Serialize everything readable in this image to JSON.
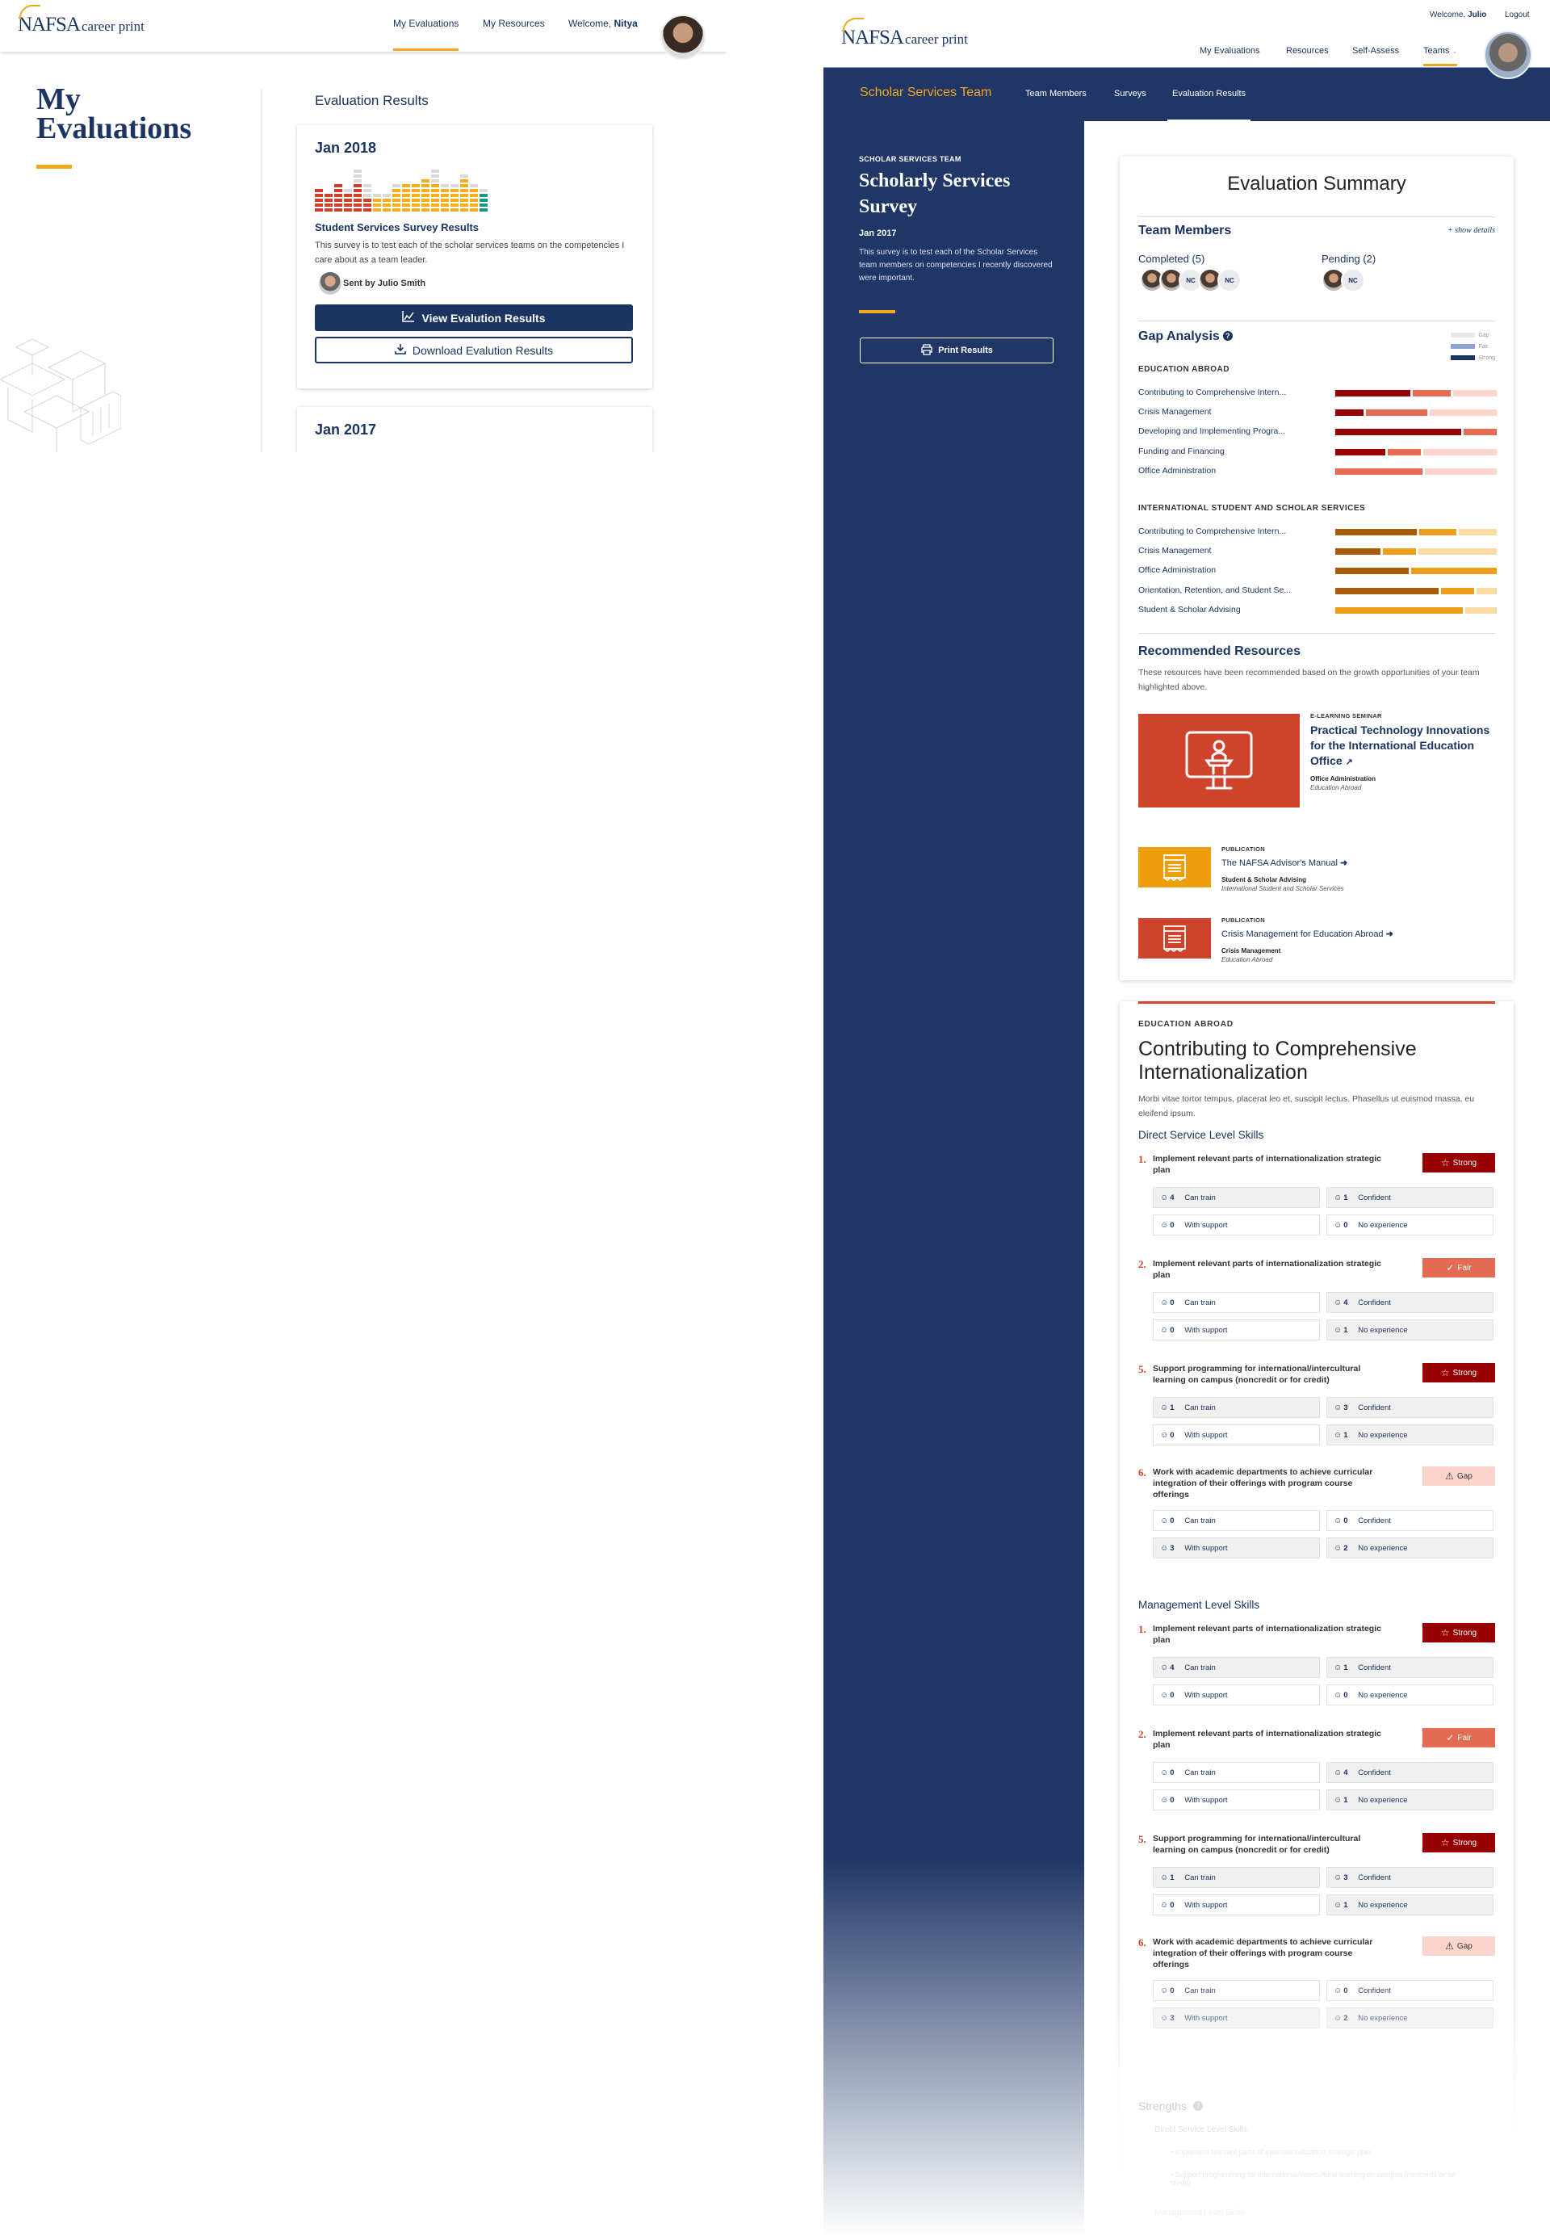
{
  "left": {
    "logo": {
      "brand": "NAFSA",
      "product": "career print"
    },
    "nav": [
      {
        "label": "My Evaluations",
        "active": true
      },
      {
        "label": "My Resources",
        "active": false
      }
    ],
    "welcome_prefix": "Welcome, ",
    "welcome_name": "Nitya",
    "page_title_line1": "My",
    "page_title_line2": "Evaluations",
    "section_title": "Evaluation Results",
    "cards": [
      {
        "date": "Jan 2018",
        "chart_columns": [
          {
            "color": "red",
            "filled": 5,
            "empty": 0
          },
          {
            "color": "red",
            "filled": 4,
            "empty": 0
          },
          {
            "color": "red",
            "filled": 6,
            "empty": 0
          },
          {
            "color": "red",
            "filled": 4,
            "empty": 1
          },
          {
            "color": "red",
            "filled": 6,
            "empty": 3
          },
          {
            "color": "red",
            "filled": 3,
            "empty": 3
          },
          {
            "color": "yellow",
            "filled": 3,
            "empty": 1
          },
          {
            "color": "yellow",
            "filled": 3,
            "empty": 1
          },
          {
            "color": "yellow",
            "filled": 5,
            "empty": 1
          },
          {
            "color": "yellow",
            "filled": 6,
            "empty": 0
          },
          {
            "color": "yellow",
            "filled": 6,
            "empty": 0
          },
          {
            "color": "yellow",
            "filled": 7,
            "empty": 0
          },
          {
            "color": "yellow",
            "filled": 6,
            "empty": 3
          },
          {
            "color": "yellow",
            "filled": 5,
            "empty": 1
          },
          {
            "color": "yellow",
            "filled": 5,
            "empty": 1
          },
          {
            "color": "yellow",
            "filled": 7,
            "empty": 1
          },
          {
            "color": "yellow",
            "filled": 5,
            "empty": 1
          },
          {
            "color": "green",
            "filled": 4,
            "empty": 1
          }
        ],
        "survey_title": "Student Services Survey Results",
        "survey_desc": "This survey is to test each of the scholar services teams on the competencies I care about as a team leader.",
        "sent_by": "Sent by Julio Smith",
        "view_label": "View Evalution Results",
        "download_label": "Download Evalution Results"
      },
      {
        "date": "Jan 2017"
      }
    ]
  },
  "right": {
    "logo": {
      "brand": "NAFSA",
      "product": "career print"
    },
    "welcome_prefix": "Welcome, ",
    "welcome_name": "Julio",
    "logout_label": "Logout",
    "nav": [
      {
        "label": "My Evaluations"
      },
      {
        "label": "Resources"
      },
      {
        "label": "Self-Assess"
      },
      {
        "label": "Teams",
        "active": true,
        "has_dropdown": true
      }
    ],
    "team_name": "Scholar Services Team",
    "subnav": [
      {
        "label": "Team Members"
      },
      {
        "label": "Surveys"
      },
      {
        "label": "Evaluation Results",
        "active": true
      }
    ],
    "sidebar": {
      "kicker": "SCHOLAR SERVICES TEAM",
      "title": "Scholarly Services Survey",
      "date": "Jan 2017",
      "desc": "This survey is to test each of the Scholar Services team members on competencies I recently discovered were important.",
      "print_label": "Print Results"
    },
    "summary": {
      "title": "Evaluation Summary",
      "team_members_title": "Team Members",
      "show_details": "+ show details",
      "completed_label": "Completed (5)",
      "completed": [
        "photo",
        "photo",
        "NC",
        "photo",
        "NC"
      ],
      "pending_label": "Pending (2)",
      "pending": [
        "photo",
        "NC"
      ],
      "gap_title": "Gap Analysis",
      "legend": [
        {
          "label": "Gap",
          "color": "#e6e8ee"
        },
        {
          "label": "Fair",
          "color": "#8fa5cf"
        },
        {
          "label": "Strong",
          "color": "#1b3461"
        }
      ],
      "gap_groups": [
        {
          "name": "EDUCATION ABROAD",
          "colors": {
            "strong": "#960000",
            "fair": "#e36a53",
            "gap": "#fbd4cc"
          },
          "rows": [
            {
              "label": "Contributing to Comprehensive Intern...",
              "strong": 48,
              "fair": 24,
              "gap": 28
            },
            {
              "label": "Crisis Management",
              "strong": 18,
              "fair": 39,
              "gap": 43
            },
            {
              "label": "Developing and Implementing Progra...",
              "strong": 79,
              "fair": 21,
              "gap": 0
            },
            {
              "label": "Funding and Financing",
              "strong": 32,
              "fair": 21,
              "gap": 47
            },
            {
              "label": "Office Administration",
              "strong": 0,
              "fair": 55,
              "gap": 45
            }
          ]
        },
        {
          "name": "INTERNATIONAL STUDENT AND SCHOLAR SERVICES",
          "colors": {
            "strong": "#a85c08",
            "fair": "#ee9d1d",
            "gap": "#fcdba3"
          },
          "rows": [
            {
              "label": "Contributing to Comprehensive Intern...",
              "strong": 52,
              "fair": 24,
              "gap": 24
            },
            {
              "label": "Crisis Management",
              "strong": 29,
              "fair": 21,
              "gap": 50
            },
            {
              "label": "Office Administration",
              "strong": 46,
              "fair": 54,
              "gap": 0
            },
            {
              "label": "Orientation, Retention, and Student Se...",
              "strong": 66,
              "fair": 21,
              "gap": 13
            },
            {
              "label": "Student & Scholar Advising",
              "strong": 0,
              "fair": 80,
              "gap": 20
            }
          ]
        }
      ],
      "resources_title": "Recommended Resources",
      "resources_desc": "These resources have been recommended based on the growth opportunities of your team highlighted above.",
      "resources": [
        {
          "type": "E-LEARNING SEMINAR",
          "title": "Practical Technology Innovations for the International Education Office",
          "title_icon": "external-link",
          "category": "Office Administration",
          "area": "Education Abroad",
          "color": "#cf432c",
          "icon": "presenter-icon"
        },
        {
          "type": "PUBLICATION",
          "title": "The NAFSA Advisor's Manual",
          "title_icon": "arrow-right",
          "category": "Student & Scholar Advising",
          "area": "International Student and Scholar Services",
          "color": "#ee9d0b",
          "icon": "document-icon"
        },
        {
          "type": "PUBLICATION",
          "title": "Crisis Management for Education Abroad",
          "title_icon": "arrow-right",
          "category": "Crisis Management",
          "area": "Education Abroad",
          "color": "#cf432c",
          "icon": "document-icon"
        }
      ]
    },
    "detail": {
      "kicker": "EDUCATION ABROAD",
      "title": "Contributing to Comprehensive Internationalization",
      "desc": "Morbi vitae tortor tempus, placerat leo et, suscipit lectus. Phasellus ut euismod massa, eu eleifend ipsum.",
      "levels": [
        {
          "title": "Direct Service Level Skills",
          "skills": [
            {
              "num": "1.",
              "text": "Implement relevant parts of internationalization strategic plan",
              "rating": "Strong",
              "counts": {
                "can_train": 4,
                "confident": 1,
                "with_support": 0,
                "no_experience": 0
              }
            },
            {
              "num": "2.",
              "text": "Implement relevant parts of internationalization strategic plan",
              "rating": "Fair",
              "counts": {
                "can_train": 0,
                "confident": 4,
                "with_support": 0,
                "no_experience": 1
              }
            },
            {
              "num": "5.",
              "text": "Support programming for international/intercultural learning on campus (noncredit or for credit)",
              "rating": "Strong",
              "counts": {
                "can_train": 1,
                "confident": 3,
                "with_support": 0,
                "no_experience": 1
              }
            },
            {
              "num": "6.",
              "text": "Work with academic departments to achieve curricular integration of their offerings with program course offerings",
              "rating": "Gap",
              "counts": {
                "can_train": 0,
                "confident": 0,
                "with_support": 3,
                "no_experience": 2
              }
            }
          ]
        },
        {
          "title": "Management Level Skills",
          "skills": [
            {
              "num": "1.",
              "text": "Implement relevant parts of internationalization strategic plan",
              "rating": "Strong",
              "counts": {
                "can_train": 4,
                "confident": 1,
                "with_support": 0,
                "no_experience": 0
              }
            },
            {
              "num": "2.",
              "text": "Implement relevant parts of internationalization strategic plan",
              "rating": "Fair",
              "counts": {
                "can_train": 0,
                "confident": 4,
                "with_support": 0,
                "no_experience": 1
              }
            },
            {
              "num": "5.",
              "text": "Support programming for international/intercultural learning on campus (noncredit or for credit)",
              "rating": "Strong",
              "counts": {
                "can_train": 1,
                "confident": 3,
                "with_support": 0,
                "no_experience": 1
              }
            },
            {
              "num": "6.",
              "text": "Work with academic departments to achieve curricular integration of their offerings with program course offerings",
              "rating": "Gap",
              "counts": {
                "can_train": 0,
                "confident": 0,
                "with_support": 3,
                "no_experience": 2
              }
            }
          ]
        }
      ],
      "count_labels": {
        "can_train": "Can train",
        "confident": "Confident",
        "with_support": "With support",
        "no_experience": "No experience"
      },
      "strengths_title": "Strengths",
      "strengths_sub": "Direct Service Level Skills",
      "strengths_items": [
        "Implement relevant parts of internationalization strategic plan",
        "Support programming for international/intercultural learning on campus (noncredit or for credit)"
      ],
      "strengths_next": "Management Level Skills"
    }
  }
}
